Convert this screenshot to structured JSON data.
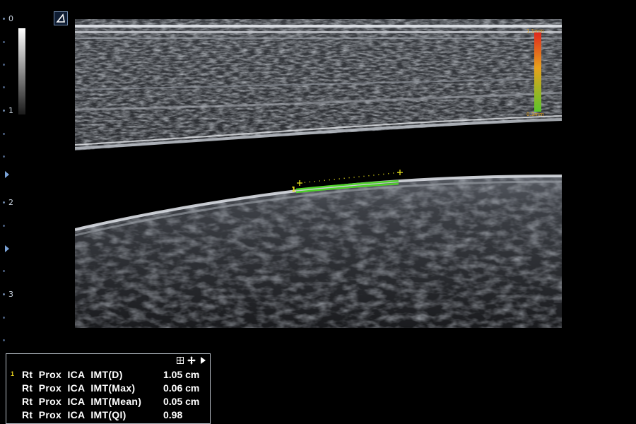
{
  "depth_scale": {
    "labels": [
      "0",
      "1",
      "2",
      "3"
    ]
  },
  "color_scale": {
    "top_label": "1.1mm",
    "bottom_label": "0.3mm"
  },
  "trace": {
    "number": "1"
  },
  "measurements": {
    "rows": [
      {
        "index": "1",
        "label": "Rt  Prox  ICA  IMT(D)",
        "value": "1.05 cm"
      },
      {
        "index": "",
        "label": "Rt  Prox  ICA  IMT(Max)",
        "value": "0.06 cm"
      },
      {
        "index": "",
        "label": "Rt  Prox  ICA  IMT(Mean)",
        "value": "0.05 cm"
      },
      {
        "index": "",
        "label": "Rt  Prox  ICA  IMT(QI)",
        "value": "0.98"
      }
    ]
  },
  "colors": {
    "trace_green": "#4fd12a",
    "caliper_yellow": "#e8e21c",
    "scale_blue": "#7aa2d6"
  }
}
